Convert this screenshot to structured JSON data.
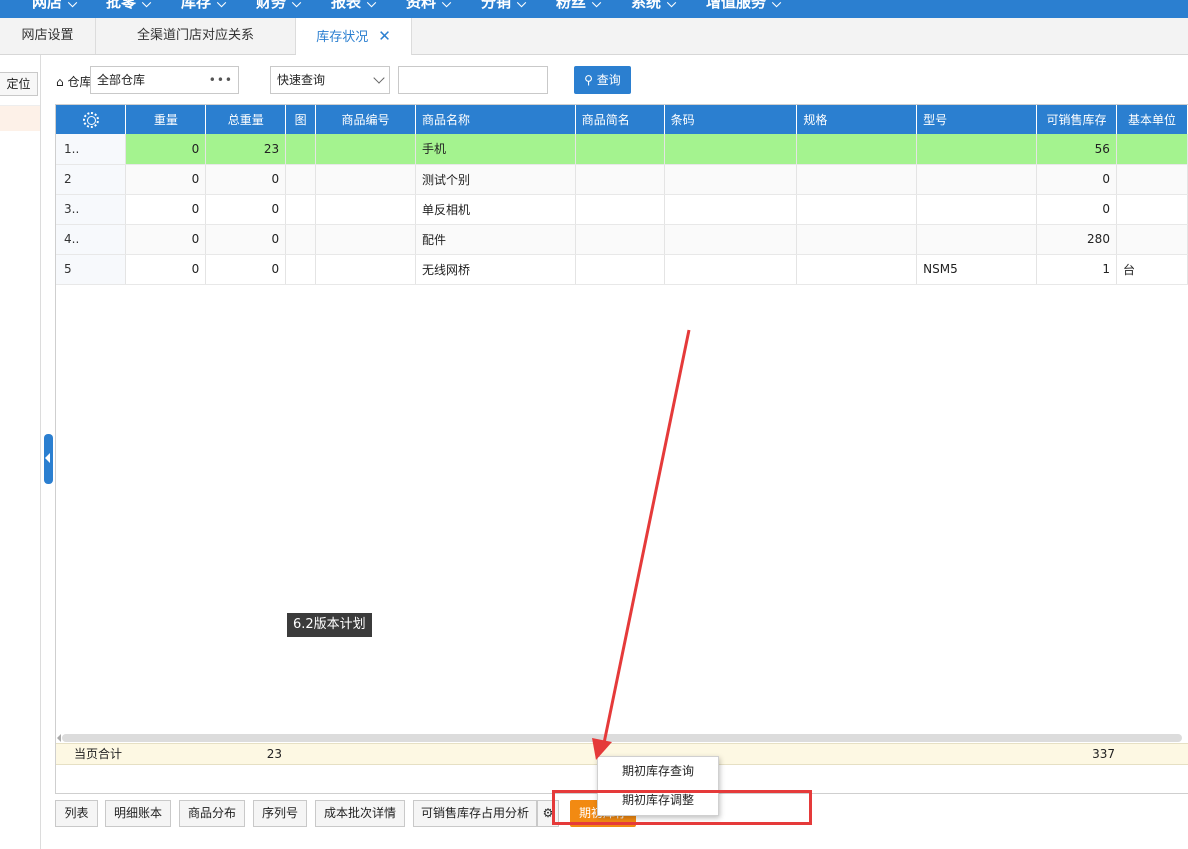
{
  "nav": {
    "menus": [
      {
        "label": "网店"
      },
      {
        "label": "批零"
      },
      {
        "label": "库存"
      },
      {
        "label": "财务"
      },
      {
        "label": "报表"
      },
      {
        "label": "资料"
      },
      {
        "label": "分销"
      },
      {
        "label": "粉丝"
      },
      {
        "label": "系统"
      },
      {
        "label": "增值服务"
      }
    ]
  },
  "tabs": [
    {
      "label": "网店设置"
    },
    {
      "label": "全渠道门店对应关系"
    },
    {
      "label": "库存状况",
      "close": "✕"
    }
  ],
  "left": {
    "locate_label": "定位"
  },
  "filter": {
    "warehouse_label": "仓库",
    "warehouse_value": "全部仓库",
    "warehouse_dots": "•••",
    "quick_query_value": "快速查询",
    "query_input_value": "",
    "query_button": "查询"
  },
  "table": {
    "headers": [
      "重量",
      "总重量",
      "图",
      "商品编号",
      "商品名称",
      "商品简名",
      "条码",
      "规格",
      "型号",
      "可销售库存",
      "基本单位"
    ],
    "rows": [
      {
        "idx": "1..",
        "weight": "0",
        "total_weight": "23",
        "img": "",
        "code": "",
        "name": "手机",
        "short": "",
        "barcode": "",
        "spec": "",
        "model": "",
        "stock": "56",
        "unit": ""
      },
      {
        "idx": "2",
        "weight": "0",
        "total_weight": "0",
        "img": "",
        "code": "",
        "name": "测试个别",
        "short": "",
        "barcode": "",
        "spec": "",
        "model": "",
        "stock": "0",
        "unit": ""
      },
      {
        "idx": "3..",
        "weight": "0",
        "total_weight": "0",
        "img": "",
        "code": "",
        "name": "单反相机",
        "short": "",
        "barcode": "",
        "spec": "",
        "model": "",
        "stock": "0",
        "unit": ""
      },
      {
        "idx": "4..",
        "weight": "0",
        "total_weight": "0",
        "img": "",
        "code": "",
        "name": "配件",
        "short": "",
        "barcode": "",
        "spec": "",
        "model": "",
        "stock": "280",
        "unit": ""
      },
      {
        "idx": "5",
        "weight": "0",
        "total_weight": "0",
        "img": "",
        "code": "",
        "name": "无线网桥",
        "short": "",
        "barcode": "",
        "spec": "",
        "model": "NSM5",
        "stock": "1",
        "unit": "台"
      }
    ],
    "totals": {
      "label": "当页合计",
      "total_weight": "23",
      "stock": "337"
    }
  },
  "tooltip": "6.2版本计划",
  "bottom_buttons": [
    "列表",
    "明细账本",
    "商品分布",
    "序列号",
    "成本批次详情",
    "可销售库存占用分析"
  ],
  "orange_button": "期初库存",
  "context_menu": [
    "期初库存查询",
    "期初库存调整"
  ],
  "colors": {
    "primary": "#2b7fd0",
    "highlight_row": "#a4f38f",
    "annotation": "#e53a3a",
    "orange": "#f28a12"
  }
}
